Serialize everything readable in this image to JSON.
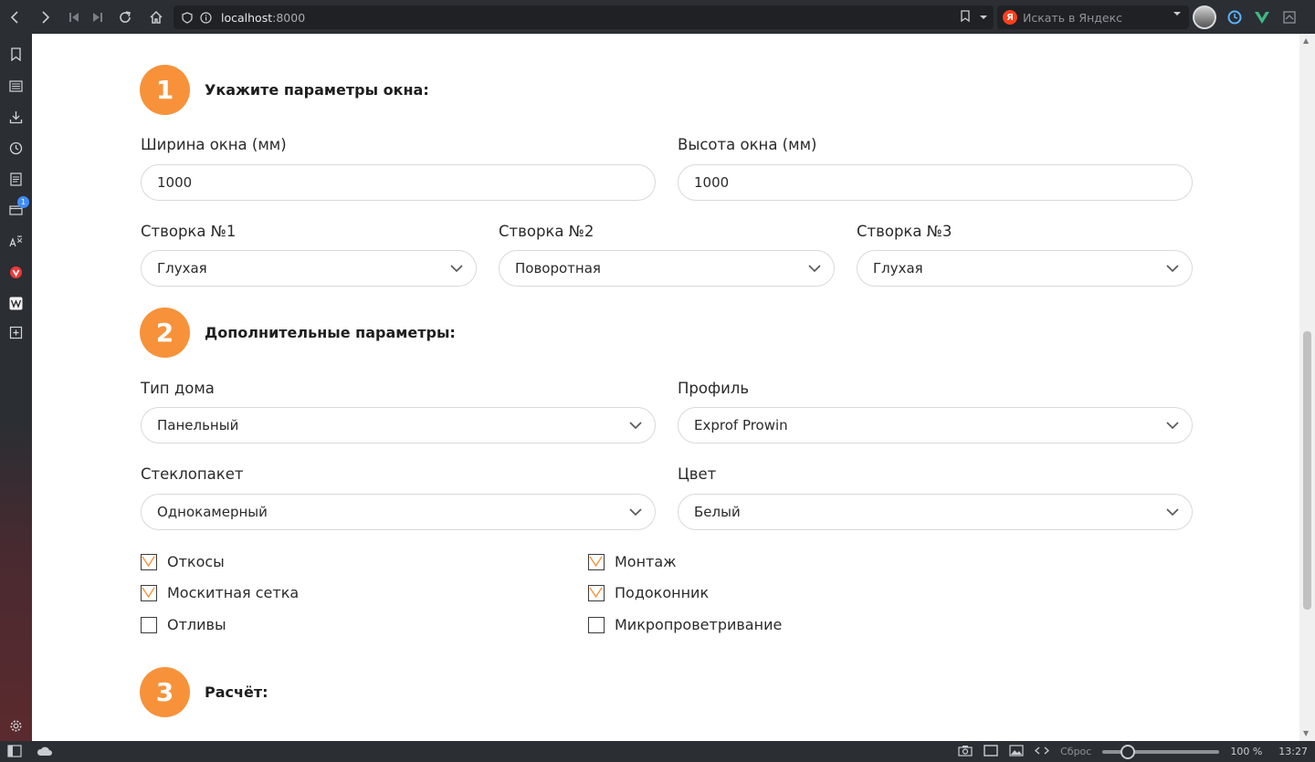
{
  "browser": {
    "url_host": "localhost",
    "url_port": ":8000",
    "search_placeholder": "Искать в Яндекс",
    "yandex_logo": "Я",
    "sidebar_badge": "1",
    "status": {
      "reset_label": "Сброс",
      "zoom_level": "100 %",
      "zoom_fraction": 0.15,
      "time": "13:27"
    }
  },
  "colors": {
    "accent": "#f7923a",
    "checkbox_check": "#f7923a"
  },
  "step1": {
    "number": "1",
    "title": "Укажите параметры окна:",
    "width_label": "Ширина окна (мм)",
    "width_value": "1000",
    "height_label": "Высота окна (мм)",
    "height_value": "1000",
    "sashes": [
      {
        "label": "Створка №1",
        "value": "Глухая"
      },
      {
        "label": "Створка №2",
        "value": "Поворотная"
      },
      {
        "label": "Створка №3",
        "value": "Глухая"
      }
    ]
  },
  "step2": {
    "number": "2",
    "title": "Дополнительные параметры:",
    "house_type_label": "Тип дома",
    "house_type_value": "Панельный",
    "profile_label": "Профиль",
    "profile_value": "Exprof Prowin",
    "glass_label": "Стеклопакет",
    "glass_value": "Однокамерный",
    "color_label": "Цвет",
    "color_value": "Белый",
    "options": [
      {
        "label": "Откосы",
        "checked": true
      },
      {
        "label": "Москитная сетка",
        "checked": true
      },
      {
        "label": "Отливы",
        "checked": false
      },
      {
        "label": "Монтаж",
        "checked": true
      },
      {
        "label": "Подоконник",
        "checked": true
      },
      {
        "label": "Микропроветривание",
        "checked": false
      }
    ]
  },
  "step3": {
    "number": "3",
    "title": "Расчёт:"
  }
}
